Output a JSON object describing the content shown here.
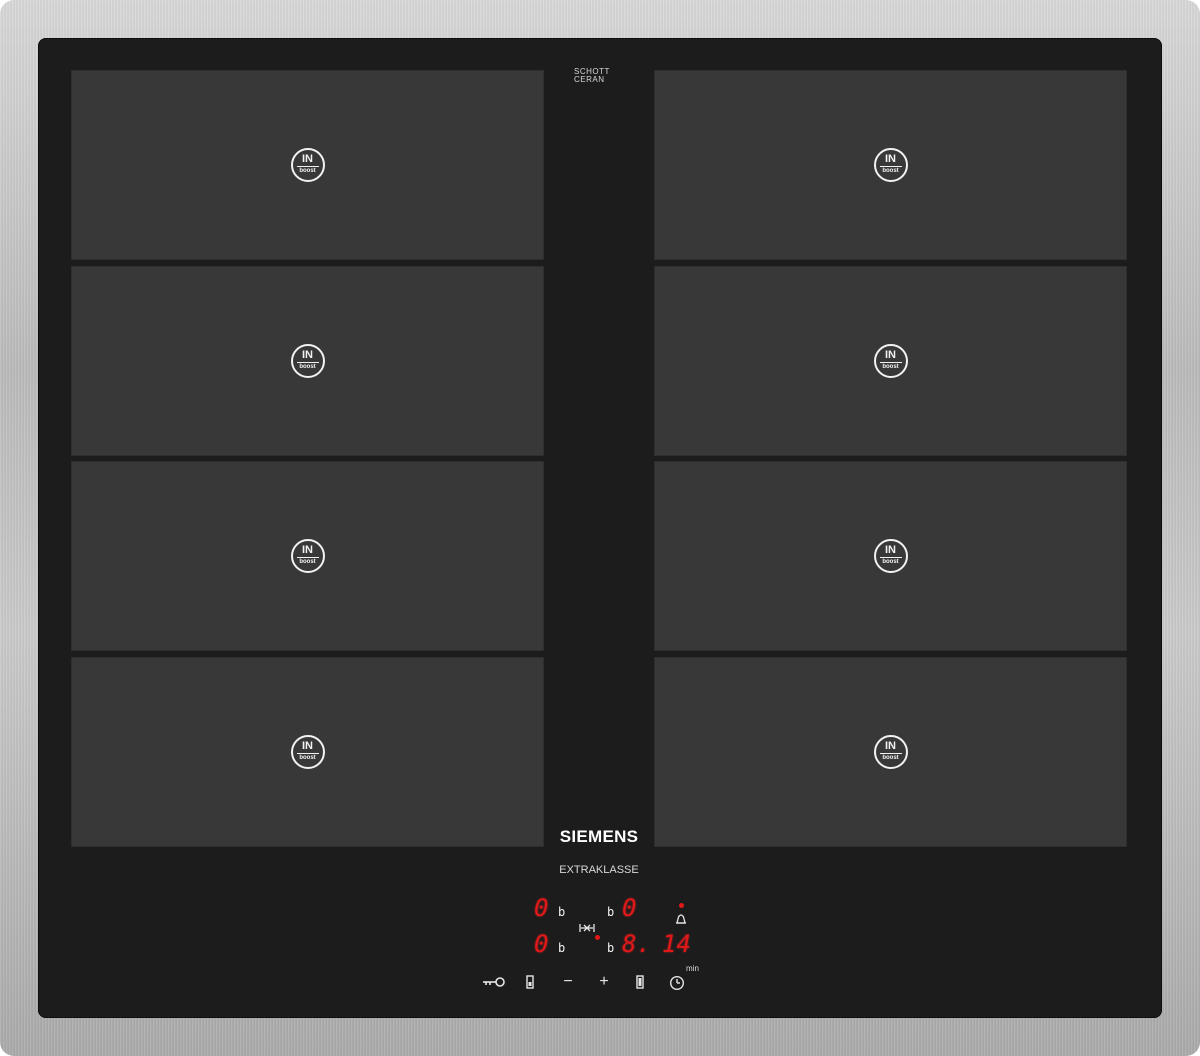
{
  "glass_branding": {
    "schott_line1": "SCHOTT",
    "schott_line2": "CERAN"
  },
  "brand": "SIEMENS",
  "series": "EXTRAKLASSE",
  "zones": [
    {
      "badge_top": "IN",
      "badge_bottom": "boost"
    },
    {
      "badge_top": "IN",
      "badge_bottom": "boost"
    },
    {
      "badge_top": "IN",
      "badge_bottom": "boost"
    },
    {
      "badge_top": "IN",
      "badge_bottom": "boost"
    },
    {
      "badge_top": "IN",
      "badge_bottom": "boost"
    },
    {
      "badge_top": "IN",
      "badge_bottom": "boost"
    },
    {
      "badge_top": "IN",
      "badge_bottom": "boost"
    },
    {
      "badge_top": "IN",
      "badge_bottom": "boost"
    }
  ],
  "display": {
    "zone_front_left_level": "0",
    "zone_front_left_boost": "b",
    "zone_back_left_level": "0",
    "zone_back_left_boost": "b",
    "zone_front_right_boost": "b",
    "zone_front_right_level": "0",
    "zone_back_right_boost": "b",
    "zone_back_right_level": "8.",
    "timer_minutes": "14",
    "timer_unit": "min"
  },
  "controls": {
    "child_lock_icon": "key-lock-icon",
    "select_left_icon": "zone-select-icon",
    "minus": "−",
    "plus": "+",
    "select_right_icon": "zone-select-icon",
    "timer_icon": "clock-icon",
    "alarm_icon": "bell-icon",
    "flex_icon": "flex-zone-icon"
  },
  "colors": {
    "glass": "#1c1c1c",
    "zone": "#383838",
    "led_red": "#e01818",
    "frame_steel": "#c0c0c0"
  }
}
